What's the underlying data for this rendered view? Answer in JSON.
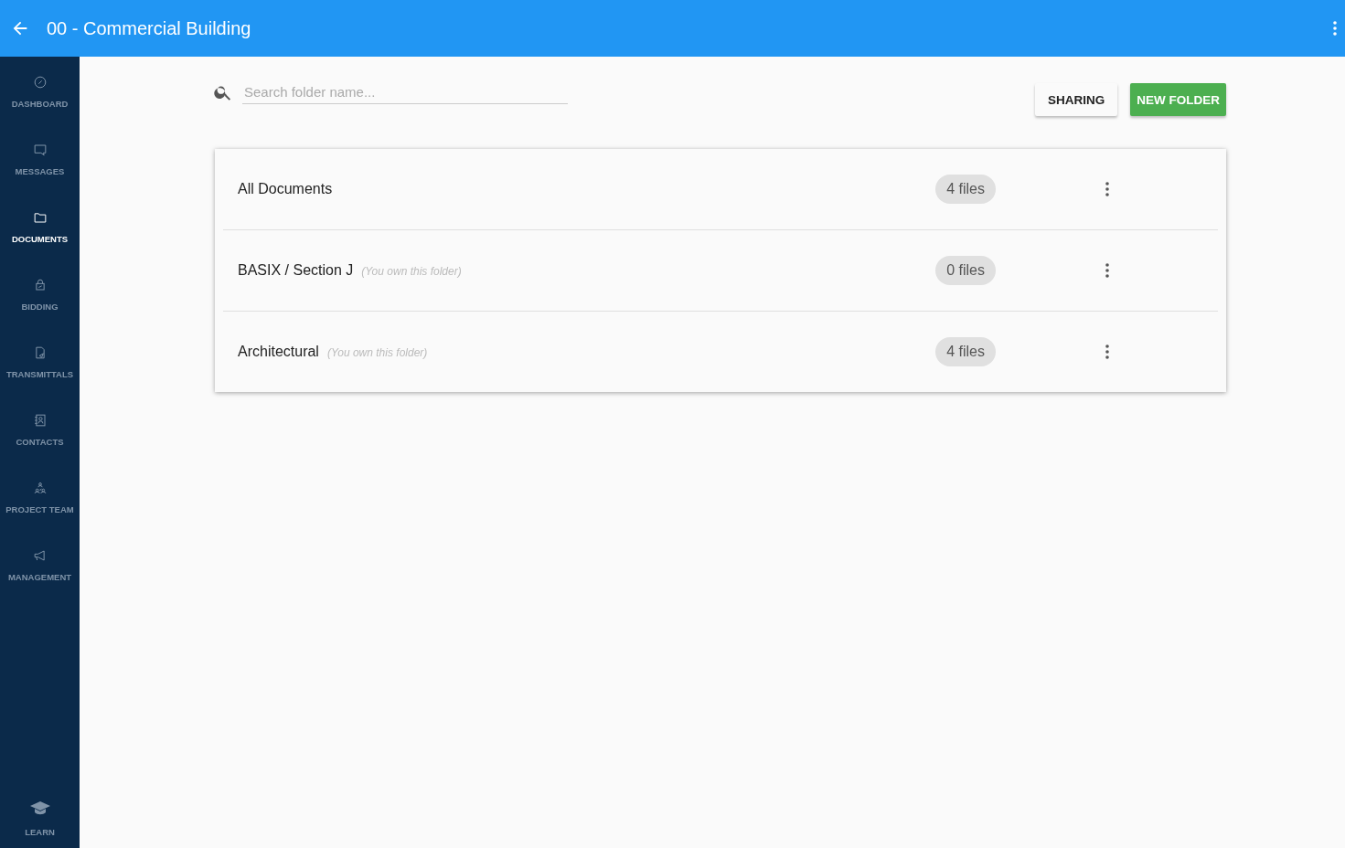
{
  "header": {
    "title": "00 - Commercial Building"
  },
  "sidebar": {
    "items": [
      {
        "label": "DASHBOARD",
        "selected": false
      },
      {
        "label": "MESSAGES",
        "selected": false
      },
      {
        "label": "DOCUMENTS",
        "selected": true
      },
      {
        "label": "BIDDING",
        "selected": false
      },
      {
        "label": "TRANSMITTALS",
        "selected": false
      },
      {
        "label": "CONTACTS",
        "selected": false
      },
      {
        "label": "PROJECT TEAM",
        "selected": false
      },
      {
        "label": "MANAGEMENT",
        "selected": false
      }
    ],
    "footer_item": {
      "label": "LEARN",
      "selected": false
    }
  },
  "search": {
    "placeholder": "Search folder name..."
  },
  "buttons": [
    {
      "label": "SHARING",
      "kind": "plain"
    },
    {
      "label": "NEW FOLDER",
      "kind": "primary"
    }
  ],
  "folders": [
    {
      "name": "All Documents",
      "count": "4 files"
    },
    {
      "name": "BASIX / Section J",
      "note": "(You own this folder)",
      "count": "0 files"
    },
    {
      "name": "Architectural",
      "note": "(You own this folder)",
      "count": "4 files"
    }
  ]
}
